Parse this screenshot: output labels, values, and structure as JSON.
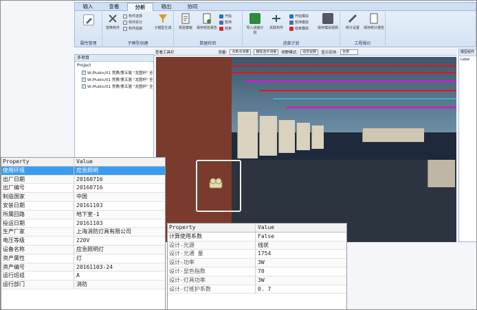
{
  "ribbon": {
    "tabs": [
      "输入",
      "查看",
      "分析",
      "输出",
      "协同"
    ],
    "active_tab": "分析",
    "groups": [
      {
        "label": "属性管理",
        "buttons": [
          "属性管理"
        ]
      },
      {
        "label": "子模型创建",
        "buttons": [
          "替换构件",
          "构件选择",
          "构件拆分",
          "构件组装",
          "子模型生成"
        ]
      },
      {
        "label": "数据校验",
        "buttons": [
          "校验模板",
          "保存校验报告",
          "开始",
          "暂停",
          "结束"
        ]
      },
      {
        "label": "进度计划",
        "buttons": [
          "导入进度计划",
          "关联构件",
          "开始模拟",
          "暂停模拟",
          "结束模拟",
          "保存模拟视频"
        ]
      },
      {
        "label": "工程报价",
        "buttons": [
          "统计设置",
          "保存统计报告"
        ]
      }
    ]
  },
  "left_panel": {
    "title": "多项目",
    "header": "Project",
    "items": [
      "W:/Public/01 竞赛/第五届 \"龙图杯\" 全",
      "W:/Public/01 竞赛/第五届 \"龙图杯\" 全",
      "W:/Public/01 竞赛/第五届 \"龙图杯\" 全"
    ]
  },
  "viewbar": {
    "title": "查看工具栏",
    "measure_label": "测量:",
    "measure_value": "点到点测量",
    "delete_value": "删除选中测量",
    "view_mode_label": "视野模式:",
    "view_mode_value": "动态视野",
    "show_label": "显示实体:",
    "show_value": "全部"
  },
  "right_panel": {
    "title": "模型组件",
    "label": "Label"
  },
  "table1": {
    "headers": [
      "Property",
      "Value"
    ],
    "rows": [
      [
        "使用环境",
        "应急照明"
      ],
      [
        "出厂日期",
        "20160716"
      ],
      [
        "出厂编号",
        "20160716"
      ],
      [
        "制造国家",
        "中国"
      ],
      [
        "安装日期",
        "20161103"
      ],
      [
        "所属回路",
        "地下室-1"
      ],
      [
        "投运日期",
        "20161103"
      ],
      [
        "生产厂家",
        "上海消防灯具有限公司"
      ],
      [
        "电压等级",
        "220V"
      ],
      [
        "设备名称",
        "应急照明灯"
      ],
      [
        "资产属性",
        "灯"
      ],
      [
        "资产编号",
        "20161103-24"
      ],
      [
        "运行班组",
        "A"
      ],
      [
        "运行部门",
        "消防"
      ]
    ]
  },
  "table2": {
    "headers": [
      "Property",
      "Value"
    ],
    "rows": [
      [
        "计算使用系数",
        "False"
      ],
      [
        "设计-光源",
        "线状"
      ],
      [
        "设计-光通 量",
        "1754"
      ],
      [
        "设计-功率",
        "3W"
      ],
      [
        "设计-显色指数",
        "70"
      ],
      [
        "设计-灯具功率",
        "3W"
      ],
      [
        "设计-灯维护系数",
        "0. 7"
      ]
    ]
  },
  "colors": {
    "selected_row": "#3b9bf0",
    "wall": "#7a3a2c",
    "pipe_red": "#e0141c",
    "pipe_magenta": "#b42cc4"
  }
}
